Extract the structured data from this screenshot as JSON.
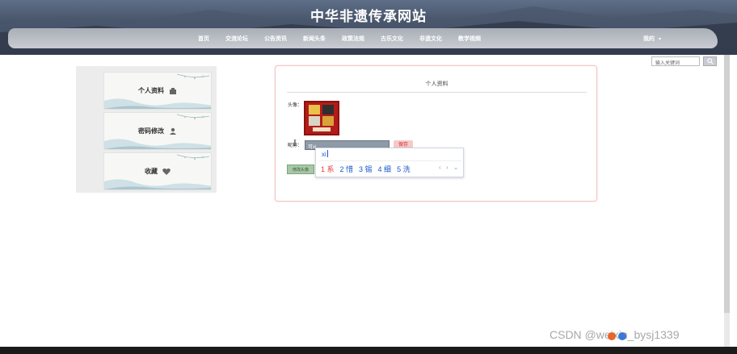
{
  "site": {
    "title": "中华非遗传承网站"
  },
  "nav": {
    "items": [
      "首页",
      "交流论坛",
      "公告资讯",
      "新闻头条",
      "政策法规",
      "古乐文化",
      "非遗文化",
      "教学视频"
    ],
    "user": "我的"
  },
  "search": {
    "placeholder": "输入关键词"
  },
  "sidebar": {
    "items": [
      {
        "label": "个人资料",
        "icon": "user-card-icon"
      },
      {
        "label": "密码修改",
        "icon": "user-icon"
      },
      {
        "label": "收藏",
        "icon": "heart-icon"
      }
    ]
  },
  "panel": {
    "title": "个人资料",
    "avatar_label": "头像：",
    "nickname_label": "昵称：",
    "nickname_value": "可xi",
    "save_label": "保存",
    "upload_label": "修改头像"
  },
  "ime": {
    "composition": "xi",
    "candidates": [
      "1 系",
      "2 惜",
      "3 锡",
      "4 细",
      "5 洗"
    ],
    "nav": "‹ › ⌄"
  },
  "watermark": "CSDN @weixin_bysj1339",
  "colors": {
    "header": "#3f4a5e",
    "nav": "#b8bdc5",
    "accent": "#c33",
    "panel_border": "#f3c5c5"
  }
}
